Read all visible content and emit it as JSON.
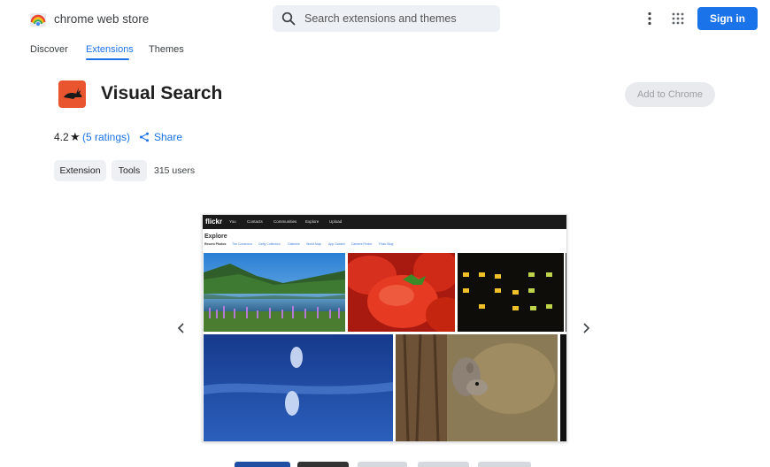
{
  "header": {
    "store_name": "chrome web store",
    "search_placeholder": "Search extensions and themes",
    "sign_in_label": "Sign in"
  },
  "nav": {
    "tabs": [
      {
        "label": "Discover",
        "active": false
      },
      {
        "label": "Extensions",
        "active": true
      },
      {
        "label": "Themes",
        "active": false
      }
    ]
  },
  "extension": {
    "title": "Visual Search",
    "add_button_label": "Add to Chrome",
    "rating": "4.2",
    "ratings_count": "(5 ratings)",
    "share_label": "Share",
    "chips": [
      "Extension",
      "Tools"
    ],
    "users": "315 users"
  },
  "screenshot": {
    "site_logo": "flickr",
    "site_nav": [
      "You",
      "Contacts",
      "Communities",
      "Explore",
      "Upload"
    ],
    "page_heading": "Explore",
    "sub_links": [
      "Recent Photos",
      "The Commons",
      "Getty Collection",
      "Galleries",
      "World Map",
      "App Garden",
      "Camera Finder",
      "Flickr Blog"
    ]
  },
  "colors": {
    "accent": "#1a73e8",
    "icon_bg": "#e8552e"
  }
}
